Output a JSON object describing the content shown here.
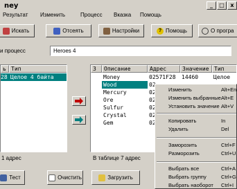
{
  "window": {
    "title": "ney"
  },
  "menu": [
    "Результат",
    "Изменить",
    "Процесс",
    "Вказка",
    "Помощь"
  ],
  "toolbar": {
    "search": "Искать",
    "filter": "Отсеять",
    "settings": "Настройки",
    "help": "Помощь",
    "about": "О програ"
  },
  "process": {
    "label": "и процесс",
    "value": "Heroes 4"
  },
  "left_table": {
    "headers": [
      "ь",
      "Тип"
    ],
    "selected_row": [
      "28",
      "Целое 4 байта"
    ]
  },
  "right_table": {
    "headers": [
      "З",
      "Описание",
      "Адрес",
      "Значение",
      "Тип"
    ],
    "rows": [
      {
        "desc": "Money",
        "addr": "02571F28",
        "value": "14460",
        "type": "Целое"
      },
      {
        "desc": "Wood",
        "addr": "02",
        "value": "",
        "type": ""
      },
      {
        "desc": "Mercury",
        "addr": "02",
        "value": "",
        "type": ""
      },
      {
        "desc": "Ore",
        "addr": "02",
        "value": "",
        "type": ""
      },
      {
        "desc": "Sulfur",
        "addr": "02",
        "value": "",
        "type": ""
      },
      {
        "desc": "Crystal",
        "addr": "02",
        "value": "",
        "type": ""
      },
      {
        "desc": "Gem",
        "addr": "02",
        "value": "",
        "type": ""
      }
    ]
  },
  "status": {
    "left": "1 адрес",
    "right": "В таблице 7 адрес"
  },
  "bottom_buttons": {
    "test": "Тест",
    "clear": "Очистить",
    "load": "Загрузить"
  },
  "context_menu": [
    {
      "label": "Изменить",
      "shortcut": "Alt+Enter"
    },
    {
      "label": "Изменить выбранные",
      "shortcut": "Alt+E"
    },
    {
      "label": "Установить значение",
      "shortcut": "Alt+V"
    },
    {
      "label": "Копировать",
      "shortcut": "In"
    },
    {
      "label": "Удалить",
      "shortcut": "Del"
    },
    {
      "label": "Заморозить",
      "shortcut": "Ctrl+F"
    },
    {
      "label": "Разморозить",
      "shortcut": "Ctrl+U"
    },
    {
      "label": "Выбрать все",
      "shortcut": "Ctrl+A"
    },
    {
      "label": "Выбрать группу",
      "shortcut": "Ctrl+G"
    },
    {
      "label": "Выбрать наоборот",
      "shortcut": "Ctrl+I"
    }
  ],
  "colors": {
    "selection": "#008080",
    "highlight_cell": "#000080",
    "face": "#d4d0c8"
  }
}
